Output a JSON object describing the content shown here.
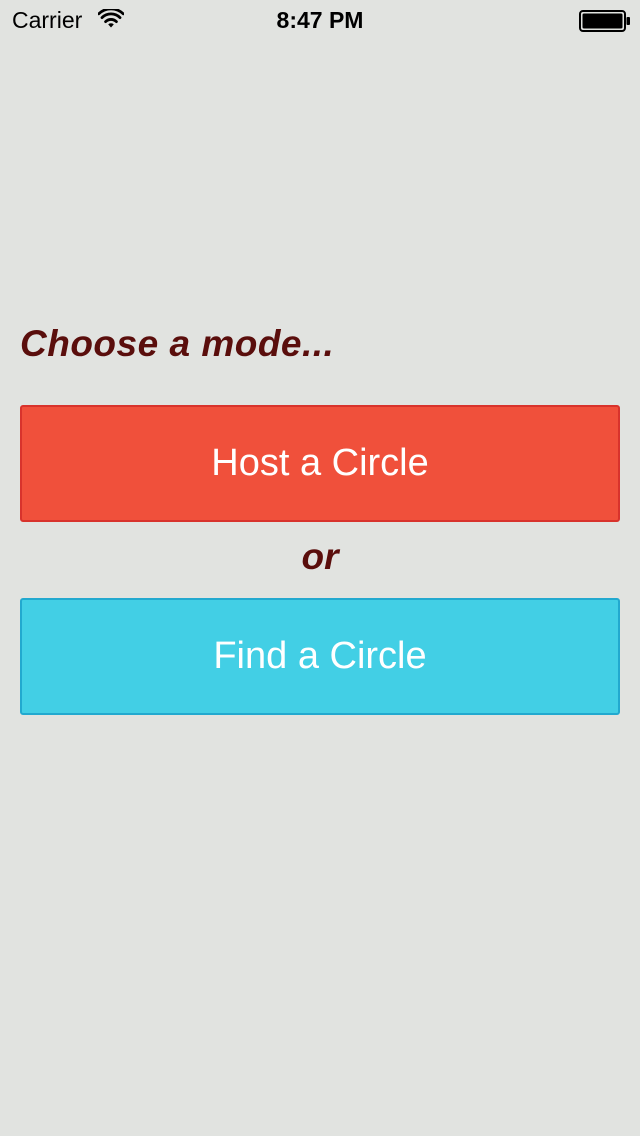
{
  "status_bar": {
    "carrier": "Carrier",
    "time": "8:47 PM",
    "wifi_icon": "wifi-icon",
    "battery_icon": "battery-icon"
  },
  "main": {
    "prompt": "Choose a mode...",
    "host_button_label": "Host a Circle",
    "separator": "or",
    "find_button_label": "Find a Circle"
  },
  "colors": {
    "background": "#e1e3e0",
    "prompt_text": "#5a0e0c",
    "host_button": "#f0503b",
    "find_button": "#42cfe5",
    "button_text": "#ffffff"
  }
}
